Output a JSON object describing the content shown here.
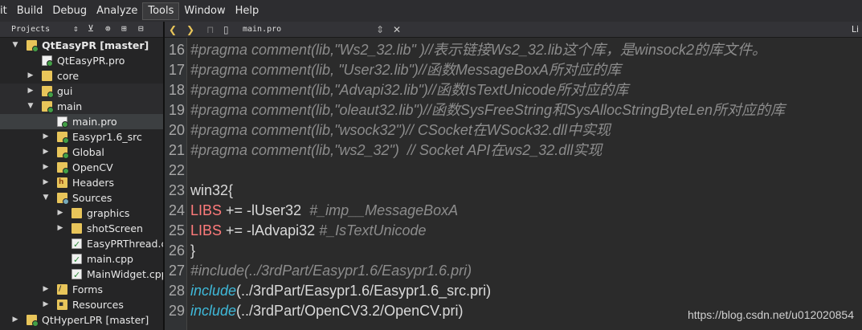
{
  "menubar": {
    "items": [
      "it",
      "Build",
      "Debug",
      "Analyze",
      "Tools",
      "Window",
      "Help"
    ],
    "active_index": 4
  },
  "sidebar": {
    "title": "Projects",
    "tree": [
      {
        "label": "QtEasyPR [master]",
        "depth": 0,
        "arrow": "down",
        "icon": "project",
        "bold": true
      },
      {
        "label": "QtEasyPR.pro",
        "depth": 1,
        "arrow": "",
        "icon": "pro-file"
      },
      {
        "label": "core",
        "depth": 1,
        "arrow": "right",
        "icon": "folder"
      },
      {
        "label": "gui",
        "depth": 1,
        "arrow": "right",
        "icon": "project"
      },
      {
        "label": "main",
        "depth": 1,
        "arrow": "down",
        "icon": "project"
      },
      {
        "label": "main.pro",
        "depth": 2,
        "arrow": "",
        "icon": "pro-file",
        "selected": true
      },
      {
        "label": "Easypr1.6_src",
        "depth": 2,
        "arrow": "right",
        "icon": "project"
      },
      {
        "label": "Global",
        "depth": 2,
        "arrow": "right",
        "icon": "project"
      },
      {
        "label": "OpenCV",
        "depth": 2,
        "arrow": "right",
        "icon": "project"
      },
      {
        "label": "Headers",
        "depth": 2,
        "arrow": "right",
        "icon": "headers"
      },
      {
        "label": "Sources",
        "depth": 2,
        "arrow": "down",
        "icon": "sources"
      },
      {
        "label": "graphics",
        "depth": 3,
        "arrow": "right",
        "icon": "folder"
      },
      {
        "label": "shotScreen",
        "depth": 3,
        "arrow": "right",
        "icon": "folder"
      },
      {
        "label": "EasyPRThread.cp",
        "depth": 3,
        "arrow": "",
        "icon": "cpp-file"
      },
      {
        "label": "main.cpp",
        "depth": 3,
        "arrow": "",
        "icon": "cpp-file"
      },
      {
        "label": "MainWidget.cpp",
        "depth": 3,
        "arrow": "",
        "icon": "cpp-file"
      },
      {
        "label": "Forms",
        "depth": 2,
        "arrow": "right",
        "icon": "forms"
      },
      {
        "label": "Resources",
        "depth": 2,
        "arrow": "right",
        "icon": "resources"
      },
      {
        "label": "QtHyperLPR [master]",
        "depth": 0,
        "arrow": "right",
        "icon": "project"
      }
    ]
  },
  "editor": {
    "tab_label": "main.pro",
    "right_label": "Li",
    "lines": [
      {
        "num": "16",
        "segments": [
          {
            "t": "#pragma comment(lib,\"Ws2_32.lib\" )//表示链接Ws2_32.lib这个库，是winsock2的库文件。",
            "c": "c-comment"
          }
        ]
      },
      {
        "num": "17",
        "segments": [
          {
            "t": "#pragma comment(lib, \"User32.lib\")//函数MessageBoxA所对应的库",
            "c": "c-comment"
          }
        ]
      },
      {
        "num": "18",
        "segments": [
          {
            "t": "#pragma comment(lib,\"Advapi32.lib\")//函数IsTextUnicode所对应的库",
            "c": "c-comment"
          }
        ]
      },
      {
        "num": "19",
        "segments": [
          {
            "t": "#pragma comment(lib,\"oleaut32.lib\")//函数SysFreeString和SysAllocStringByteLen所对应的库",
            "c": "c-comment"
          }
        ]
      },
      {
        "num": "20",
        "segments": [
          {
            "t": "#pragma comment(lib,\"wsock32\")// CSocket在WSock32.dll中实现",
            "c": "c-comment"
          }
        ]
      },
      {
        "num": "21",
        "segments": [
          {
            "t": "#pragma comment(lib,\"ws2_32\")  // Socket API在ws2_32.dll实现",
            "c": "c-comment"
          }
        ]
      },
      {
        "num": "22",
        "segments": []
      },
      {
        "num": "23",
        "segments": [
          {
            "t": "win32{",
            "c": "c-plain"
          }
        ]
      },
      {
        "num": "24",
        "segments": [
          {
            "t": "LIBS",
            "c": "c-libs"
          },
          {
            "t": " += -lUser32  ",
            "c": "c-plain"
          },
          {
            "t": "#_imp__MessageBoxA",
            "c": "c-cmt2"
          }
        ]
      },
      {
        "num": "25",
        "segments": [
          {
            "t": "LIBS",
            "c": "c-libs"
          },
          {
            "t": " += -lAdvapi32 ",
            "c": "c-plain"
          },
          {
            "t": "#_IsTextUnicode",
            "c": "c-cmt2"
          }
        ]
      },
      {
        "num": "26",
        "segments": [
          {
            "t": "}",
            "c": "c-plain"
          }
        ]
      },
      {
        "num": "27",
        "segments": [
          {
            "t": "#include(../3rdPart/Easypr1.6/Easypr1.6.pri)",
            "c": "c-comment"
          }
        ]
      },
      {
        "num": "28",
        "segments": [
          {
            "t": "include",
            "c": "c-include"
          },
          {
            "t": "(../3rdPart/Easypr1.6/Easypr1.6_src.pri)",
            "c": "c-plain"
          }
        ]
      },
      {
        "num": "29",
        "segments": [
          {
            "t": "include",
            "c": "c-include"
          },
          {
            "t": "(../3rdPart/OpenCV3.2/OpenCV.pri)",
            "c": "c-plain"
          }
        ]
      }
    ]
  },
  "watermark": "https://blog.csdn.net/u012020854"
}
